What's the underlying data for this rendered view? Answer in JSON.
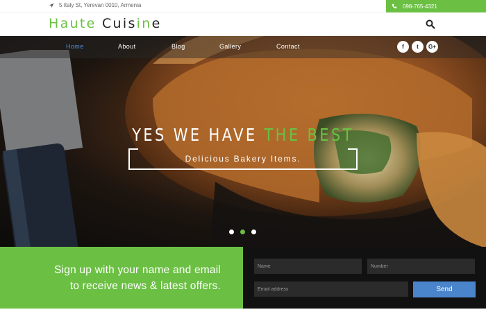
{
  "topbar": {
    "address": "5 Italy St, Yerevan 0010, Armenia",
    "phone": "098-765-4321"
  },
  "header": {
    "logo_part1": "Haute",
    "logo_part2a": "Cuis",
    "logo_part2b": "in",
    "logo_part2c": "e"
  },
  "nav": {
    "items": [
      {
        "label": "Home"
      },
      {
        "label": "About"
      },
      {
        "label": "Blog"
      },
      {
        "label": "Gallery"
      },
      {
        "label": "Contact"
      }
    ],
    "social": [
      "f",
      "t",
      "G+"
    ]
  },
  "hero": {
    "headline_white": "YES WE HAVE ",
    "headline_green": "THE BEST",
    "subtitle": "Delicious Bakery Items."
  },
  "signup": {
    "line1": "Sign up with your name and email",
    "line2": "to receive news & latest offers.",
    "name_placeholder": "Name",
    "number_placeholder": "Number",
    "email_placeholder": "Email address",
    "send_label": "Send"
  },
  "colors": {
    "accent_green": "#6bc043",
    "accent_blue": "#4a85cc"
  }
}
